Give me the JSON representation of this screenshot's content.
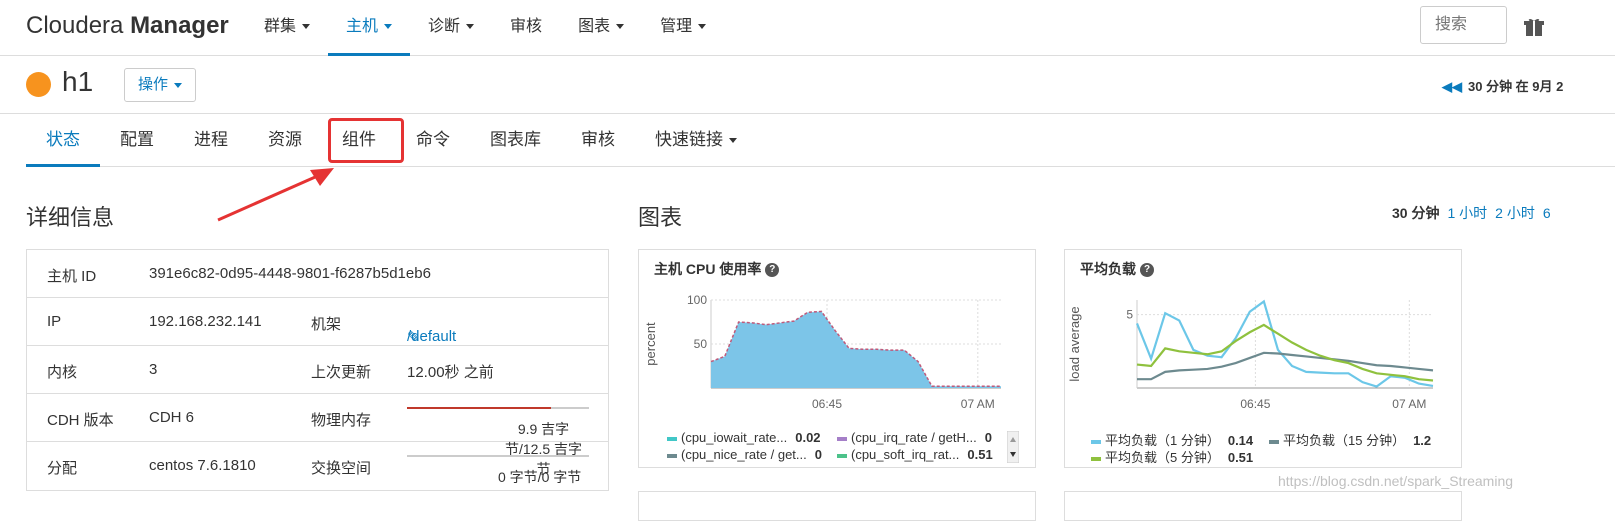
{
  "header": {
    "brand_light": "Cloudera ",
    "brand_bold": "Manager",
    "nav": [
      {
        "label": "群集",
        "dropdown": true
      },
      {
        "label": "主机",
        "dropdown": true,
        "active": true
      },
      {
        "label": "诊断",
        "dropdown": true
      },
      {
        "label": "审核",
        "dropdown": false
      },
      {
        "label": "图表",
        "dropdown": true
      },
      {
        "label": "管理",
        "dropdown": true
      }
    ],
    "search_placeholder": "搜索"
  },
  "host": {
    "name": "h1",
    "status_color": "#f7931e",
    "actions_label": "操作",
    "time_range_text": "30 分钟 在 9月 2"
  },
  "tabs": [
    "状态",
    "配置",
    "进程",
    "资源",
    "组件",
    "命令",
    "图表库",
    "审核",
    "快速链接"
  ],
  "details": {
    "title": "详细信息",
    "rows": [
      {
        "k1": "主机 ID",
        "v1": "391e6c82-0d95-4448-9801-f6287b5d1eb6"
      },
      {
        "k1": "IP",
        "v1": "192.168.232.141",
        "k2": "机架",
        "v2": "/default"
      },
      {
        "k1": "内核",
        "v1": "3",
        "k2": "上次更新",
        "v2": "12.00秒 之前"
      },
      {
        "k1": "CDH 版本",
        "v1": "CDH 6",
        "k2": "物理内存",
        "v2": "9.9 吉字节/12.5 吉字节"
      },
      {
        "k1": "分配",
        "v1": "centos 7.6.1810",
        "k2": "交换空间",
        "v2": "0 字节/0 字节"
      }
    ],
    "memory_fraction": 0.79,
    "swap_fraction": 0
  },
  "charts_section": {
    "title": "图表",
    "ranges": [
      "30 分钟",
      "1 小时",
      "2 小时",
      "6"
    ]
  },
  "chart_data": [
    {
      "type": "area",
      "title": "主机 CPU 使用率",
      "ylabel": "percent",
      "ylim": [
        0,
        100
      ],
      "yticks": [
        50,
        100
      ],
      "xticks": [
        "06:45",
        "07 AM"
      ],
      "grid": true,
      "legend_position": "bottom",
      "series": [
        {
          "name": "(cpu_iowait_rate...",
          "value_label": "0.02",
          "color": "#41c7c7"
        },
        {
          "name": "(cpu_irq_rate / getH...",
          "value_label": "0",
          "color": "#a57fc8"
        },
        {
          "name": "(cpu_nice_rate / get...",
          "value_label": "0",
          "color": "#6d8a8f"
        },
        {
          "name": "(cpu_soft_irq_rat...",
          "value_label": "0.51",
          "color": "#4cc28a"
        }
      ],
      "area_values": [
        30,
        36,
        75,
        74,
        72,
        74,
        76,
        86,
        87,
        65,
        45,
        44,
        44,
        43,
        43,
        30,
        2,
        2,
        2,
        2,
        2,
        2
      ],
      "area_color": "#7cc5e8"
    },
    {
      "type": "line",
      "title": "平均负载",
      "ylabel": "load average",
      "yticks": [
        5
      ],
      "ylim": [
        0,
        6
      ],
      "xticks": [
        "06:45",
        "07 AM"
      ],
      "grid": true,
      "legend_position": "bottom",
      "series": [
        {
          "name": "平均负载（1 分钟）",
          "value_label": "0.14",
          "color": "#6cc7e8",
          "values": [
            4.4,
            2.0,
            5.1,
            4.6,
            2.6,
            2.2,
            2.1,
            3.4,
            5.2,
            5.9,
            2.6,
            1.5,
            1.1,
            1.05,
            1.0,
            1.0,
            0.4,
            0.1,
            0.8,
            0.7,
            0.3,
            0.14
          ]
        },
        {
          "name": "平均负载（15 分钟）",
          "value_label": "1.2",
          "color": "#6d8a8f",
          "values": [
            0.6,
            0.6,
            1.1,
            1.2,
            1.25,
            1.3,
            1.45,
            1.7,
            2.05,
            2.4,
            2.35,
            2.25,
            2.15,
            2.05,
            1.95,
            1.85,
            1.7,
            1.55,
            1.5,
            1.4,
            1.3,
            1.2
          ]
        },
        {
          "name": "平均负载（5 分钟）",
          "value_label": "0.51",
          "color": "#8fc13e",
          "values": [
            1.6,
            1.5,
            2.7,
            2.5,
            2.4,
            2.3,
            2.5,
            3.2,
            3.8,
            4.3,
            3.7,
            3.1,
            2.6,
            2.2,
            1.9,
            1.7,
            1.3,
            1.0,
            0.9,
            0.8,
            0.6,
            0.51
          ]
        }
      ]
    }
  ],
  "watermark": "https://blog.csdn.net/spark_Streaming"
}
